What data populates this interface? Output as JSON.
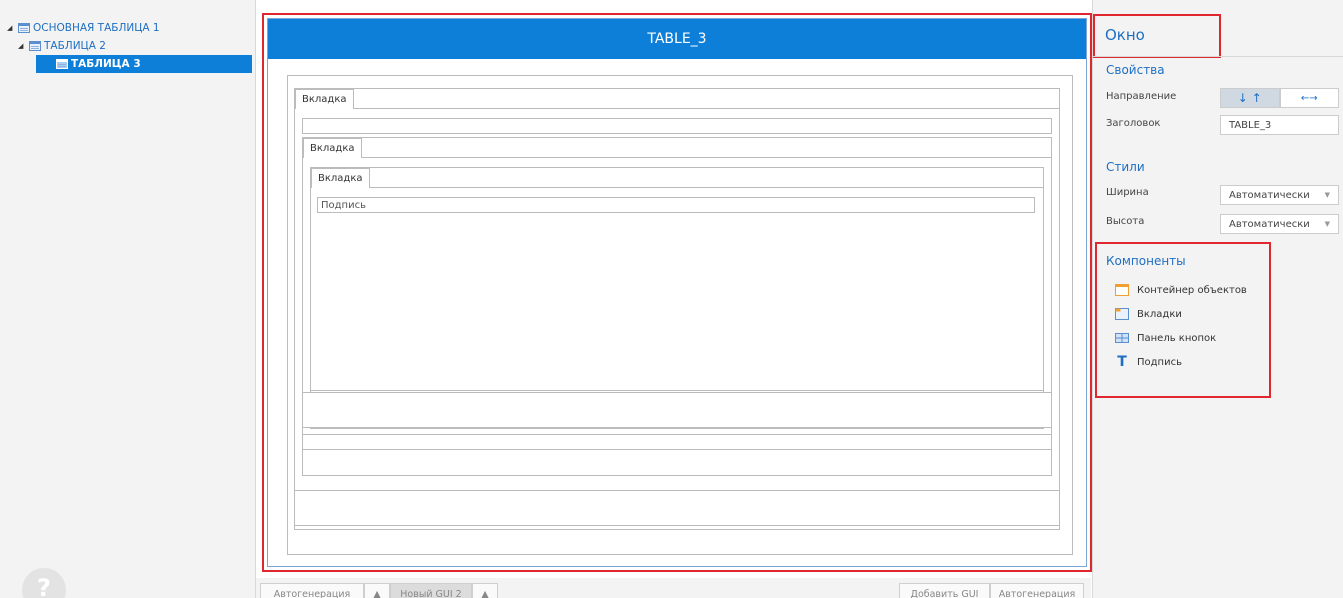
{
  "tree": {
    "nodes": [
      {
        "label": "ОСНОВНАЯ ТАБЛИЦА 1",
        "icon": "table-icon",
        "expanded": true
      },
      {
        "label": "ТАБЛИЦА 2",
        "icon": "table-icon",
        "expanded": true
      },
      {
        "label": "ТАБЛИЦА 3",
        "icon": "table-icon",
        "selected": true
      }
    ],
    "help_icon": "?"
  },
  "designer": {
    "window_title": "TABLE_3",
    "tab_label": "Вкладка",
    "caption_label": "Подпись"
  },
  "bottom_bar": {
    "left_buttons": [
      "Автогенерация",
      "Новый GUI 2"
    ],
    "right_buttons": [
      "Добавить GUI",
      "Автогенерация"
    ]
  },
  "panel": {
    "title": "Окно",
    "properties_header": "Свойства",
    "direction_label": "Направление",
    "direction_vertical": "↓ ↑",
    "direction_horizontal": "←→",
    "caption_label": "Заголовок",
    "caption_value": "TABLE_3",
    "styles_header": "Стили",
    "width_label": "Ширина",
    "width_value": "Автоматически",
    "height_label": "Высота",
    "height_value": "Автоматически",
    "components_header": "Компоненты",
    "components": [
      {
        "label": "Контейнер объектов",
        "icon": "container-icon"
      },
      {
        "label": "Вкладки",
        "icon": "tabs-icon"
      },
      {
        "label": "Панель кнопок",
        "icon": "button-panel-icon"
      },
      {
        "label": "Подпись",
        "icon": "text-label-icon"
      }
    ]
  },
  "colors": {
    "accent": "#0e7fd8",
    "link": "#1d6fc4",
    "highlight": "#e0262e"
  }
}
